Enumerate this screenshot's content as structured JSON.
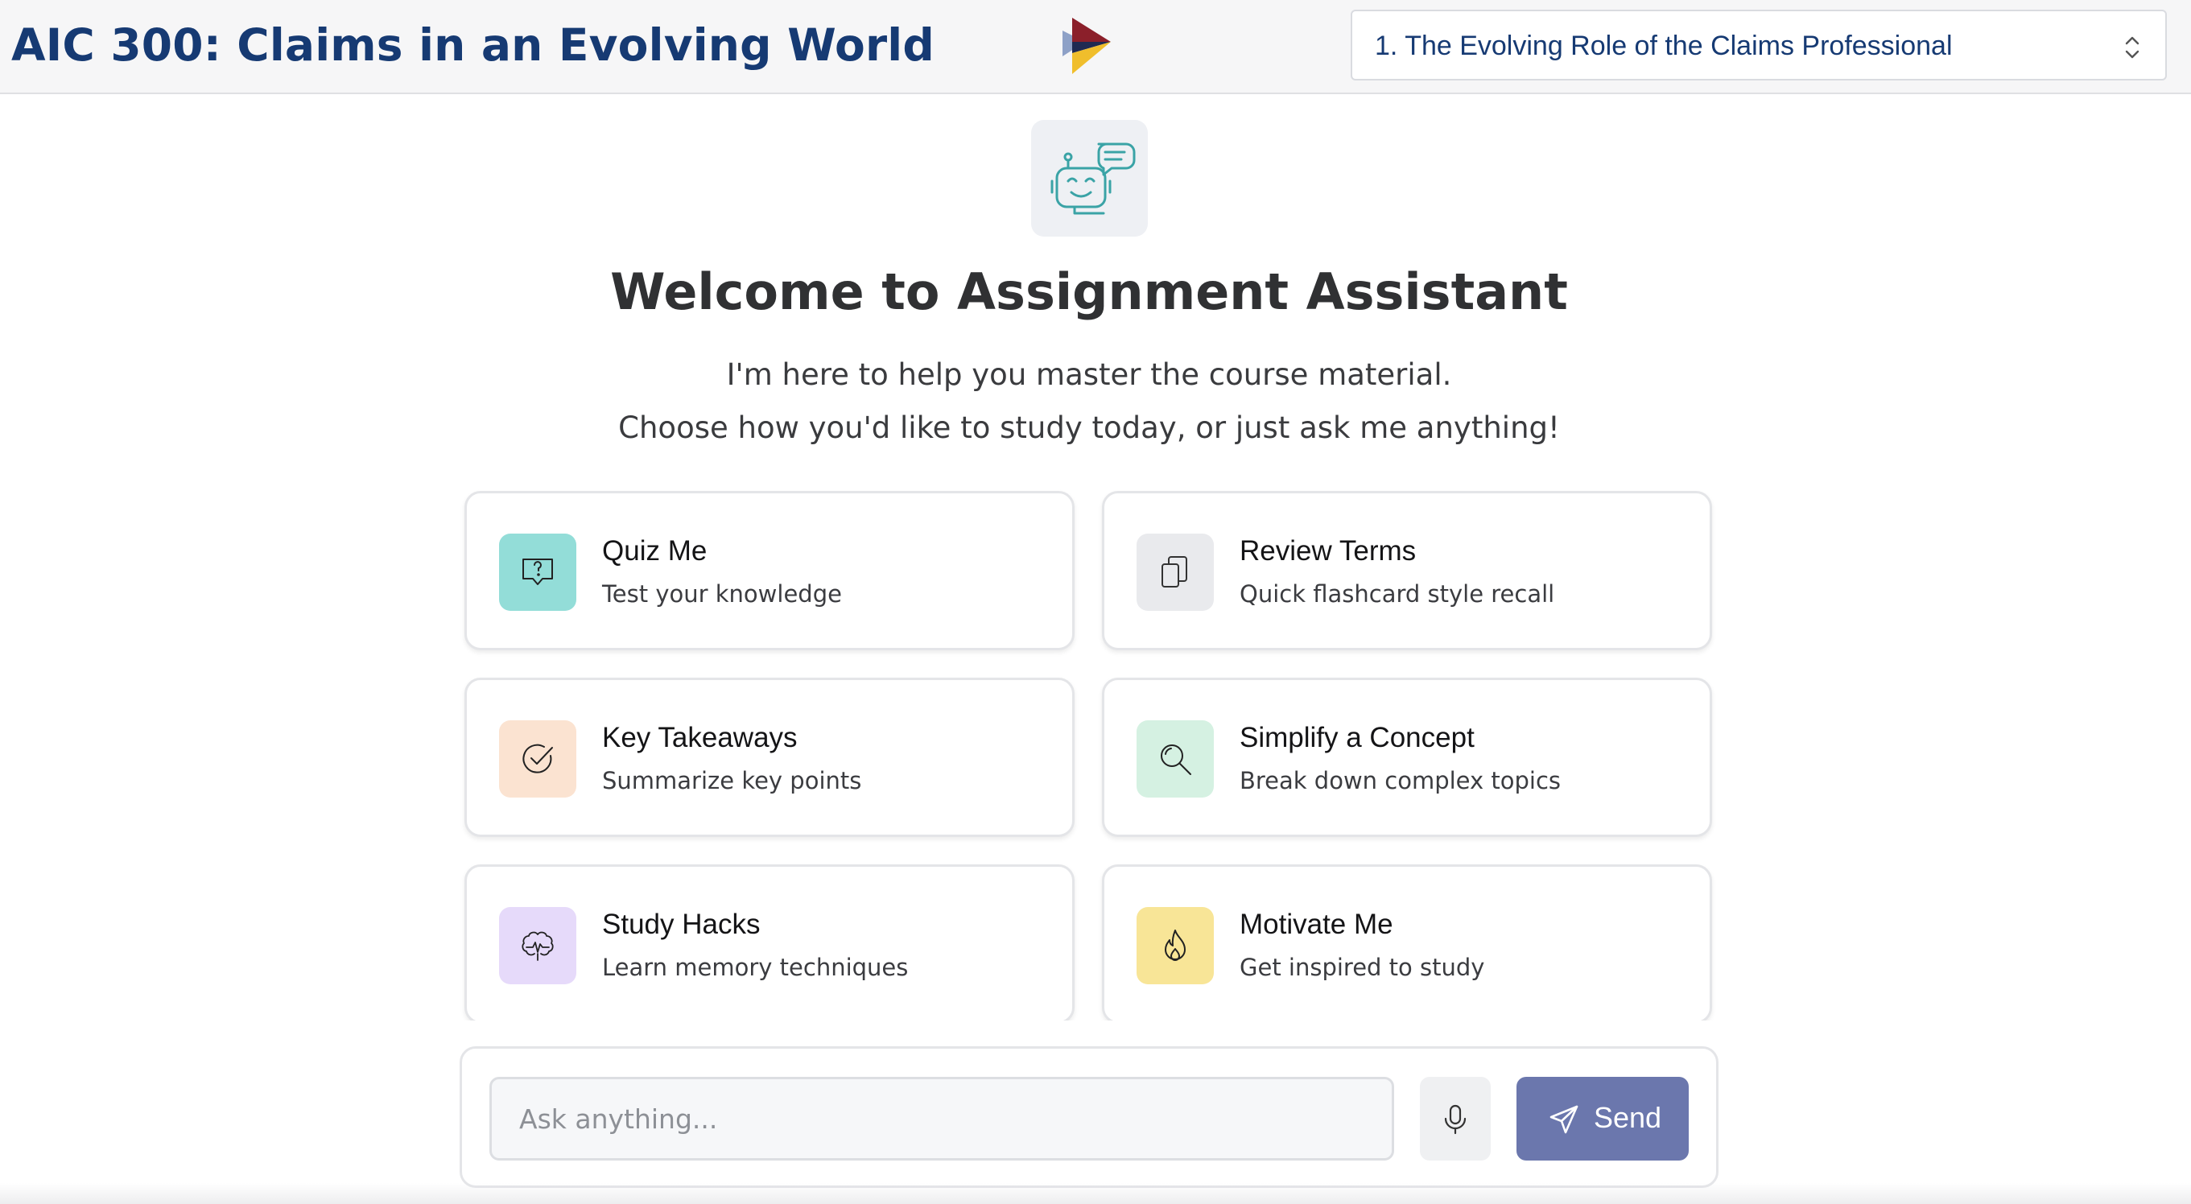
{
  "header": {
    "app_title": "AIC 300: Claims in an Evolving World",
    "chapter_selected": "1. The Evolving Role of the Claims Professional"
  },
  "welcome": {
    "title": "Welcome to Assignment Assistant",
    "line1": "I'm here to help you master the course material.",
    "line2": "Choose how you'd like to study today, or just ask me anything!"
  },
  "cards": [
    {
      "title": "Quiz Me",
      "desc": "Test your knowledge",
      "icon": "quiz-icon",
      "color": "#93ddd8"
    },
    {
      "title": "Review Terms",
      "desc": "Quick flashcard style recall",
      "icon": "flashcards-icon",
      "color": "#e9eaed"
    },
    {
      "title": "Key Takeaways",
      "desc": "Summarize key points",
      "icon": "check-circle-icon",
      "color": "#fbe3d1"
    },
    {
      "title": "Simplify a Concept",
      "desc": "Break down complex topics",
      "icon": "magnifier-icon",
      "color": "#d5f1e2"
    },
    {
      "title": "Study Hacks",
      "desc": "Learn memory techniques",
      "icon": "brain-icon",
      "color": "#e6dafa"
    },
    {
      "title": "Motivate Me",
      "desc": "Get inspired to study",
      "icon": "flame-icon",
      "color": "#f8e597"
    }
  ],
  "composer": {
    "placeholder": "Ask anything...",
    "send_label": "Send"
  },
  "colors": {
    "title_blue": "#163a73",
    "send_button": "#6b77ad",
    "bot_teal": "#3aa3a6"
  }
}
